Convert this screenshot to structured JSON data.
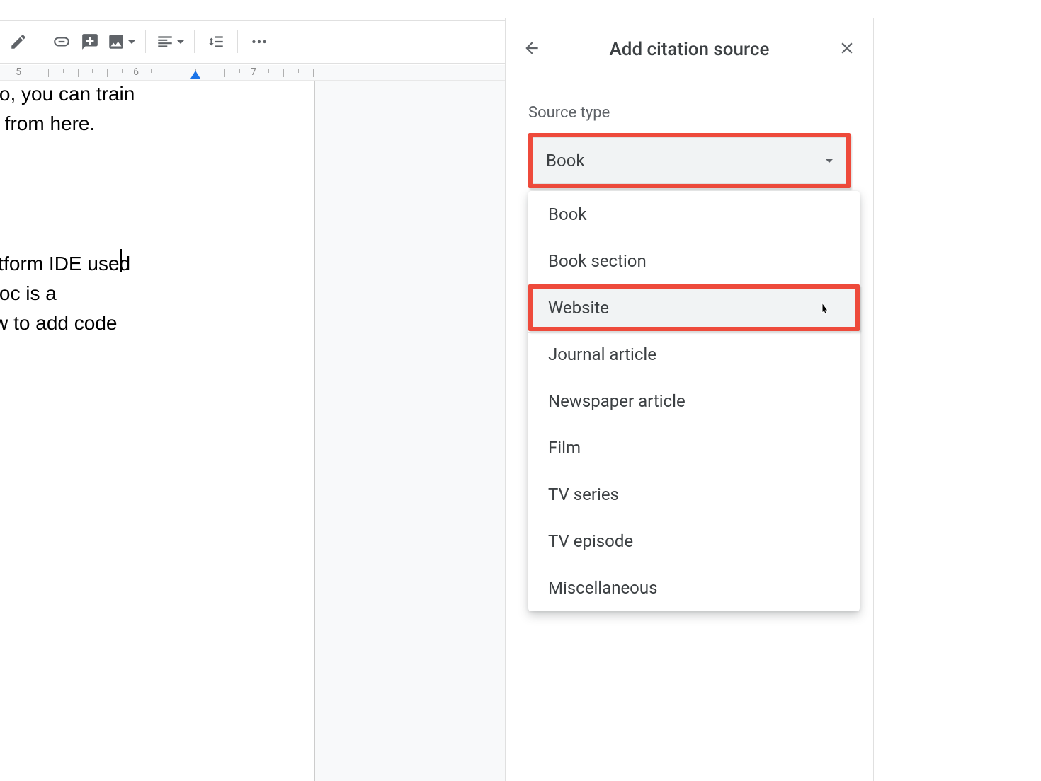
{
  "toolbar": {
    "icons": {
      "highlighter": "highlighter-icon",
      "link": "link-icon",
      "comment": "comment-icon",
      "image": "image-icon",
      "align": "align-left-icon",
      "line_spacing": "line-spacing-icon",
      "more": "more-icon",
      "edit_mode": "pencil-icon",
      "collapse": "chevron-up-icon"
    }
  },
  "ruler": {
    "marks": [
      "5",
      "6",
      "7"
    ]
  },
  "document": {
    "line_frag_1_a": "Also, you can train",
    "line_frag_1_b": "me from here.",
    "line_frag_2_a": "platform IDE used",
    "line_frag_2_b": "e doc is a",
    "line_frag_2_c": "how to add code"
  },
  "citation": {
    "title": "Add citation source",
    "source_type_label": "Source type",
    "selected_value": "Book",
    "options": [
      "Book",
      "Book section",
      "Website",
      "Journal article",
      "Newspaper article",
      "Film",
      "TV series",
      "TV episode",
      "Miscellaneous"
    ]
  },
  "annotations": {
    "highlight_color": "#ee4a3b",
    "highlighted_dropdown_index": 2
  }
}
